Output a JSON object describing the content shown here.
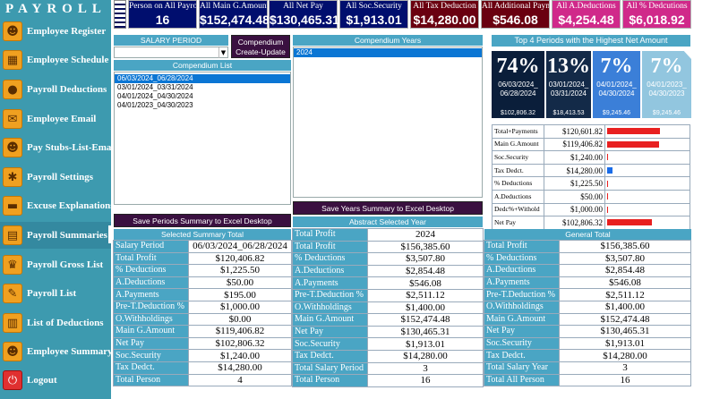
{
  "app_title": "PAYROLL",
  "nav": [
    {
      "label": "Employee Register",
      "icon": "employee-register-icon",
      "glyph": "☻"
    },
    {
      "label": "Employee Schedule",
      "icon": "schedule-icon",
      "glyph": "▦"
    },
    {
      "label": "Payroll Deductions",
      "icon": "deductions-icon",
      "glyph": "●"
    },
    {
      "label": "Employee Email",
      "icon": "email-icon",
      "glyph": "✉"
    },
    {
      "label": "Pay Stubs-List-Email",
      "icon": "pay-stubs-icon",
      "glyph": "☻"
    },
    {
      "label": "Payroll Settings",
      "icon": "gear-icon",
      "glyph": "✱"
    },
    {
      "label": "Excuse Explanations",
      "icon": "excuse-icon",
      "glyph": "▬"
    },
    {
      "label": "Payroll Summaries",
      "icon": "summaries-icon",
      "glyph": "▤"
    },
    {
      "label": "Payroll Gross List",
      "icon": "gross-list-icon",
      "glyph": "♛"
    },
    {
      "label": "Payroll List",
      "icon": "payroll-list-icon",
      "glyph": "✎"
    },
    {
      "label": "List of Deductions",
      "icon": "deductions-list-icon",
      "glyph": "▥"
    },
    {
      "label": "Employee Summary",
      "icon": "employee-summary-icon",
      "glyph": "☻"
    },
    {
      "label": "Logout",
      "icon": "power-icon",
      "glyph": "⏻"
    }
  ],
  "cards": [
    {
      "title": "Person on All Payro",
      "value": "16"
    },
    {
      "title": "All Main G.Amount",
      "value": "$152,474.48"
    },
    {
      "title": "All Net Pay",
      "value": "$130,465.31"
    },
    {
      "title": "All Soc.Security",
      "value": "$1,913.01"
    },
    {
      "title": "All Tax Deduction",
      "value": "$14,280.00"
    },
    {
      "title": "All Additional Paym",
      "value": "$546.08"
    },
    {
      "title": "All A.Deductions",
      "value": "$4,254.48"
    },
    {
      "title": "All % Dedcutions",
      "value": "$6,018.92"
    }
  ],
  "salary_period_label": "SALARY PERIOD",
  "salary_period_value": "",
  "compendium_create_label": "Compendium Create-Update",
  "compendium_list": {
    "title": "Compendium List",
    "items": [
      "06/03/2024_06/28/2024",
      "03/01/2024_03/31/2024",
      "04/01/2024_04/30/2024",
      "04/01/2023_04/30/2023"
    ]
  },
  "compendium_years": {
    "title": "Compendium Years",
    "items": [
      "2024"
    ]
  },
  "save_periods_label": "Save Periods Summary to Excel Desktop",
  "save_years_label": "Save Years Summary to Excel Desktop",
  "top4": {
    "title": "Top 4 Periods with the Highest Net Amount",
    "tiles": [
      {
        "pct": "74%",
        "dates": "06/03/2024_ 06/28/2024",
        "amount": "$102,806.32",
        "bg": "#0a1e3a"
      },
      {
        "pct": "13%",
        "dates": "03/01/2024_ 03/31/2024",
        "amount": "$18,413.53",
        "bg": "#132a48"
      },
      {
        "pct": "7%",
        "dates": "04/01/2024_ 04/30/2024",
        "amount": "$9,245.46",
        "bg": "#3b7fd8"
      },
      {
        "pct": "7%",
        "dates": "04/01/2023_ 04/30/2023",
        "amount": "$9,245.46",
        "bg": "#92c6df"
      }
    ]
  },
  "bars": [
    {
      "label": "Total+Payments",
      "value": "$120,601.82",
      "frac": 0.98,
      "color": "red"
    },
    {
      "label": "Main G.Amount",
      "value": "$119,406.82",
      "frac": 0.97,
      "color": "red"
    },
    {
      "label": "Soc.Security",
      "value": "$1,240.00",
      "frac": 0.01,
      "color": "red"
    },
    {
      "label": "Tax Dedct.",
      "value": "$14,280.00",
      "frac": 0.1,
      "color": "blue"
    },
    {
      "label": "% Deductions",
      "value": "$1,225.50",
      "frac": 0.01,
      "color": "red"
    },
    {
      "label": "A.Deductions",
      "value": "$50.00",
      "frac": 0,
      "color": "red"
    },
    {
      "label": "Dedc%+Withold",
      "value": "$1,000.00",
      "frac": 0.01,
      "color": "red"
    },
    {
      "label": "Net Pay",
      "value": "$102,806.32",
      "frac": 0.84,
      "color": "red"
    }
  ],
  "selected_summary": {
    "title": "Selected Summary Total",
    "rows": [
      [
        "Salary Period",
        "06/03/2024_06/28/2024"
      ],
      [
        "Total Profit",
        "$120,406.82"
      ],
      [
        "% Deductions",
        "$1,225.50"
      ],
      [
        "A.Deductions",
        "$50.00"
      ],
      [
        "A.Payments",
        "$195.00"
      ],
      [
        "Pre-T.Deduction %",
        "$1,000.00"
      ],
      [
        "O.Withholdings",
        "$0.00"
      ],
      [
        "Main G.Amount",
        "$119,406.82"
      ],
      [
        "Net Pay",
        "$102,806.32"
      ],
      [
        "Soc.Security",
        "$1,240.00"
      ],
      [
        "Tax Dedct.",
        "$14,280.00"
      ],
      [
        "Total Person",
        "4"
      ]
    ]
  },
  "abstract_year": {
    "title": "Abstract Selected Year",
    "rows": [
      [
        "Total Profit",
        "2024"
      ],
      [
        "Total Profit",
        "$156,385.60"
      ],
      [
        "% Deductions",
        "$3,507.80"
      ],
      [
        "A.Deductions",
        "$2,854.48"
      ],
      [
        "A.Payments",
        "$546.08"
      ],
      [
        "Pre-T.Deduction %",
        "$2,511.12"
      ],
      [
        "O.Withholdings",
        "$1,400.00"
      ],
      [
        "Main G.Amount",
        "$152,474.48"
      ],
      [
        "Net Pay",
        "$130,465.31"
      ],
      [
        "Soc.Security",
        "$1,913.01"
      ],
      [
        "Tax Dedct.",
        "$14,280.00"
      ],
      [
        "Total Salary Period",
        "3"
      ],
      [
        "Total Person",
        "16"
      ]
    ]
  },
  "general_total": {
    "title": "General Total",
    "rows": [
      [
        "Total Profit",
        "$156,385.60"
      ],
      [
        "% Deductions",
        "$3,507.80"
      ],
      [
        "A.Deductions",
        "$2,854.48"
      ],
      [
        "A.Payments",
        "$546.08"
      ],
      [
        "Pre-T.Deduction %",
        "$2,511.12"
      ],
      [
        "O.Withholdings",
        "$1,400.00"
      ],
      [
        "Main G.Amount",
        "$152,474.48"
      ],
      [
        "Net Pay",
        "$130,465.31"
      ],
      [
        "Soc.Security",
        "$1,913.01"
      ],
      [
        "Tax Dedct.",
        "$14,280.00"
      ],
      [
        "Total Salary Year",
        "3"
      ],
      [
        "Total All Person",
        "16"
      ]
    ]
  }
}
